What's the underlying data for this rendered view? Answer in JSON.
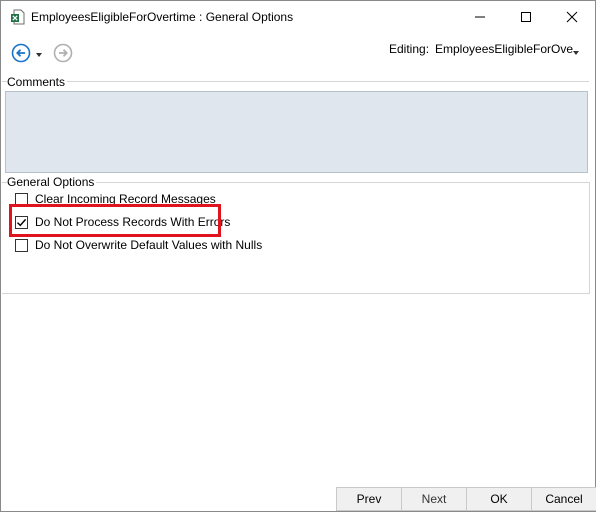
{
  "window": {
    "title": "EmployeesEligibleForOvertime : General Options",
    "app_icon": "excel-file-icon"
  },
  "toolbar": {
    "back_icon": "arrow-left-circle-icon",
    "forward_icon": "arrow-right-circle-icon",
    "editing_label": "Editing:",
    "editing_value": "EmployeesEligibleForOve"
  },
  "comments": {
    "label": "Comments",
    "value": ""
  },
  "general_options": {
    "label": "General Options",
    "items": [
      {
        "label": "Clear Incoming Record Messages",
        "checked": false
      },
      {
        "label": "Do Not Process Records With Errors",
        "checked": true
      },
      {
        "label": "Do Not Overwrite Default Values with Nulls",
        "checked": false
      }
    ]
  },
  "buttons": {
    "prev": "Prev",
    "next": "Next",
    "ok": "OK",
    "cancel": "Cancel"
  },
  "colors": {
    "highlight": "#e0141e",
    "comments_bg": "#dfe6ee",
    "nav_back": "#1a73c9",
    "nav_disabled": "#b0b0b0"
  }
}
